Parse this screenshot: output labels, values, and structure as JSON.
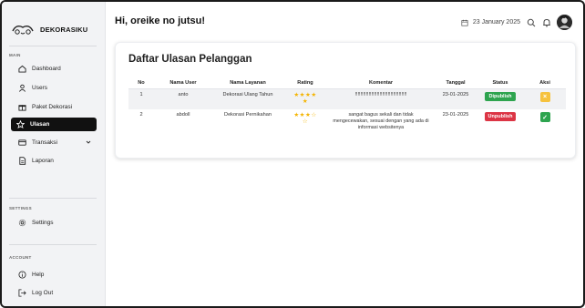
{
  "brand": {
    "name": "DEKORASIKU"
  },
  "sidebar": {
    "main_label": "MAIN",
    "settings_label": "SETTINGS",
    "account_label": "ACCOUNT",
    "items": [
      {
        "label": "Dashboard",
        "icon": "home-icon"
      },
      {
        "label": "Users",
        "icon": "user-icon"
      },
      {
        "label": "Paket Dekorasi",
        "icon": "gift-icon"
      },
      {
        "label": "Ulasan",
        "icon": "star-icon",
        "active": true
      },
      {
        "label": "Transaksi",
        "icon": "card-icon"
      },
      {
        "label": "Laporan",
        "icon": "report-icon"
      }
    ],
    "settings_item": {
      "label": "Settings",
      "icon": "gear-icon"
    },
    "help_item": {
      "label": "Help",
      "icon": "info-icon"
    },
    "logout_item": {
      "label": "Log Out",
      "icon": "logout-icon"
    }
  },
  "header": {
    "greeting": "Hi, oreike no jutsu!",
    "date": "23 January 2025"
  },
  "main": {
    "title": "Daftar Ulasan Pelanggan",
    "columns": [
      "No",
      "Nama User",
      "Nama Layanan",
      "Rating",
      "Komentar",
      "Tanggal",
      "Status",
      "Aksi"
    ],
    "rows": [
      {
        "no": "1",
        "user": "anto",
        "service": "Dekorasi Ulang Tahun",
        "rating": 5,
        "rating_display": "★★★★\n★",
        "comment": "!!!!!!!!!!!!!!!!!!!!!!!!!!!!!!!!!!!!!!",
        "date": "23-01-2025",
        "status": "Dipublish",
        "action": "×"
      },
      {
        "no": "2",
        "user": "abdoll",
        "service": "Dekorasi Pernikahan",
        "rating": 3,
        "rating_display": "★★★☆\n☆",
        "comment": "sangat bagus sekali dan tidak mengecewakan, sesuai dengan yang ada di informasi websitenya",
        "date": "23-01-2025",
        "status": "Unpublish",
        "action": "✓"
      }
    ]
  },
  "colors": {
    "published": "#2ea44f",
    "unpublished": "#dc3545",
    "warn": "#f6c23e",
    "star": "#f4b400",
    "active_nav": "#111111"
  }
}
